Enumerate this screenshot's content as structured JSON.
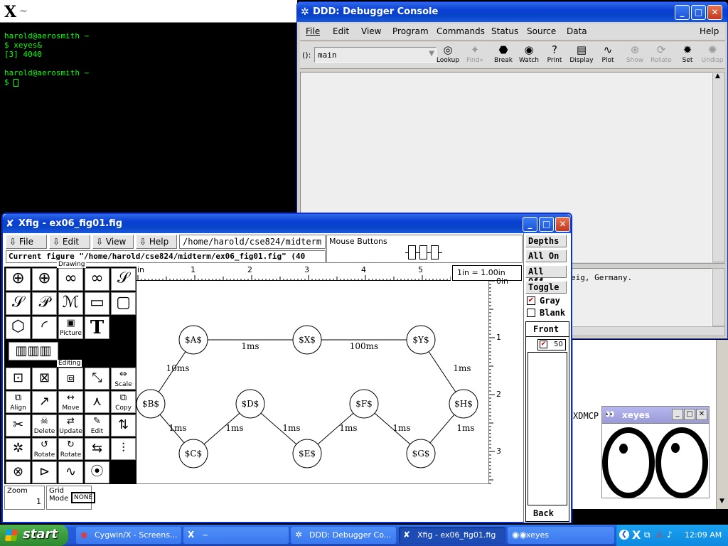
{
  "terminal": {
    "lines": [
      "harold@aerosmith ~",
      "$ xeyes&",
      "[3] 4040",
      "",
      "harold@aerosmith ~",
      "$ "
    ],
    "title_glyph": "X",
    "title_suffix": "~"
  },
  "ddd": {
    "title": "DDD: Debugger Console",
    "menu": [
      "File",
      "Edit",
      "View",
      "Program",
      "Commands",
      "Status",
      "Source",
      "Data",
      "Help"
    ],
    "arg_label": "():",
    "arg_value": "main",
    "tools": [
      {
        "label": "Lookup",
        "icon": "lookup-icon",
        "enabled": true
      },
      {
        "label": "Find»",
        "icon": "find-icon",
        "enabled": false
      },
      {
        "label": "Break",
        "icon": "stop-icon",
        "enabled": true
      },
      {
        "label": "Watch",
        "icon": "watch-icon",
        "enabled": true
      },
      {
        "label": "Print",
        "icon": "print-icon",
        "enabled": true
      },
      {
        "label": "Display",
        "icon": "display-icon",
        "enabled": true
      },
      {
        "label": "Plot",
        "icon": "plot-icon",
        "enabled": true
      },
      {
        "label": "Show",
        "icon": "show-icon",
        "enabled": false
      },
      {
        "label": "Rotate",
        "icon": "rotate-icon",
        "enabled": false
      },
      {
        "label": "Set",
        "icon": "set-icon",
        "enabled": true
      },
      {
        "label": "Undisp",
        "icon": "undisp-icon",
        "enabled": false
      }
    ],
    "console_text": "eig, Germany."
  },
  "xfig": {
    "title": "Xfig - ex06_fig01.fig",
    "menu": [
      "File",
      "Edit",
      "View",
      "Help"
    ],
    "path": "/home/harold/cse824/midterm",
    "mouse_buttons_label": "Mouse Buttons",
    "current_figure": "Current figure \"/home/harold/cse824/midterm/ex06_fig01.fig\" (40",
    "drawing_label": "Drawing",
    "editing_label": "Editing",
    "ruler_ticks": [
      "in",
      "1",
      "2",
      "3",
      "4",
      "5"
    ],
    "vruler_ticks": [
      "0in",
      "1",
      "2",
      "3"
    ],
    "unit_label": "1in = 1.00in",
    "draw_tool_labels": {
      "picture": "Picture",
      "text": "T"
    },
    "edit_tool_labels": {
      "scale": "Scale",
      "align": "Align",
      "move": "Move",
      "copy": "Copy",
      "delete": "Delete",
      "update": "Update",
      "edit": "Edit",
      "rotate_ccw": "Rotate",
      "rotate_cw": "Rotate"
    },
    "zoom_label": "Zoom",
    "zoom_value": "1",
    "grid_label": "Grid\nMode",
    "grid_value": "NONE",
    "depths": {
      "header": "Depths",
      "all_on": "All On",
      "all_off": "All Off",
      "toggle": "Toggle",
      "gray": "Gray",
      "blank": "Blank",
      "front": "Front",
      "layer": "50",
      "back": "Back"
    },
    "nodes": [
      "$A$",
      "$X$",
      "$Y$",
      "$B$",
      "$D$",
      "$F$",
      "$H$",
      "$C$",
      "$E$",
      "$G$"
    ],
    "edge_labels": [
      "10ms",
      "1ms",
      "100ms",
      "1ms",
      "1ms",
      "1ms",
      "1ms",
      "1ms",
      "1ms",
      "1ms"
    ]
  },
  "xeyes": {
    "title": "xeyes",
    "behind_text": "XDMCP"
  },
  "taskbar": {
    "start": "start",
    "items": [
      {
        "label": "Cygwin/X - Screens...",
        "icon": "cygwin-icon",
        "active": false
      },
      {
        "label": "~",
        "icon": "x-icon",
        "active": false
      },
      {
        "label": "DDD: Debugger Co...",
        "icon": "ddd-icon",
        "active": false
      },
      {
        "label": "Xfig - ex06_fig01.fig",
        "icon": "xfig-icon",
        "active": true
      },
      {
        "label": "xeyes",
        "icon": "xeyes-icon",
        "active": false
      }
    ],
    "clock": "12:09 AM"
  },
  "colors": {
    "xp_blue": "#0a3fd3",
    "taskbar": "#245edb",
    "start_green": "#3c9b3c",
    "terminal_text": "#00ff00"
  }
}
